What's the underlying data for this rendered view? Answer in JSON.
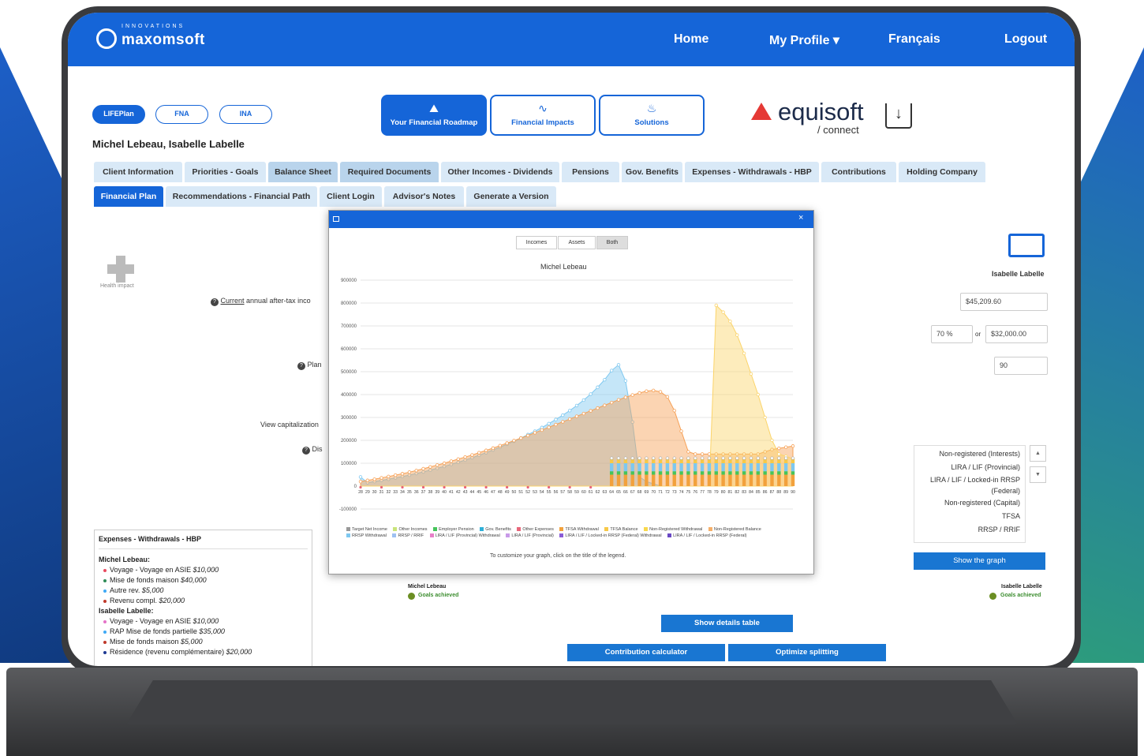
{
  "header": {
    "logo_top": "INNOVATIONS",
    "logo_name": "maxomsoft",
    "nav_home": "Home",
    "nav_profile": "My Profile ▾",
    "nav_lang": "Français",
    "nav_logout": "Logout"
  },
  "plan_pills": [
    "LIFEPlan",
    "FNA",
    "INA"
  ],
  "top_buttons": [
    {
      "label": "Your Financial Roadmap",
      "icon": "map-icon"
    },
    {
      "label": "Financial Impacts",
      "icon": "line-graph-icon"
    },
    {
      "label": "Solutions",
      "icon": "lightbulb-icon"
    }
  ],
  "partner": {
    "name": "equisoft",
    "sub": "/ connect"
  },
  "clients": "Michel Lebeau, Isabelle Labelle",
  "tabs_row1": [
    "Client Information",
    "Priorities - Goals",
    "Balance Sheet",
    "Required Documents",
    "Other Incomes - Dividends",
    "Pensions",
    "Gov. Benefits",
    "Expenses - Withdrawals - HBP",
    "Contributions",
    "Holding Company"
  ],
  "tabs_row2": [
    "Financial Plan",
    "Recommendations - Financial Path",
    "Client Login",
    "Advisor's Notes",
    "Generate a Version"
  ],
  "left": {
    "health_impact": "Health impact",
    "current_label": "Current",
    "current_rest": " annual after-tax inco",
    "plan_label": "Plan",
    "view_cap": "View capitalization",
    "dist_label": "Dis"
  },
  "modal": {
    "segments": [
      "Incomes",
      "Assets",
      "Both"
    ],
    "hint": "To customize your graph, click on the title of the legend."
  },
  "chart_data": {
    "type": "area",
    "title": "Michel Lebeau",
    "x": [
      28,
      29,
      30,
      31,
      32,
      33,
      34,
      35,
      36,
      37,
      38,
      39,
      40,
      41,
      42,
      43,
      44,
      45,
      46,
      47,
      48,
      49,
      50,
      51,
      52,
      53,
      54,
      55,
      56,
      57,
      58,
      59,
      60,
      61,
      62,
      63,
      64,
      65,
      66,
      67,
      68,
      69,
      70,
      71,
      72,
      73,
      74,
      75,
      76,
      77,
      78,
      79,
      80,
      81,
      82,
      83,
      84,
      85,
      86,
      87,
      88,
      89,
      90
    ],
    "ylim": [
      -100000,
      900000
    ],
    "yticks": [
      "900000",
      "800000",
      "700000",
      "600000",
      "500000",
      "400000",
      "300000",
      "200000",
      "100000",
      "0",
      "-100000"
    ],
    "series": [
      {
        "name": "Non-Registered Balance",
        "color": "#7ec8f0",
        "values": [
          40000,
          15000,
          20000,
          25000,
          30000,
          36000,
          42000,
          48000,
          55000,
          62000,
          70000,
          78000,
          86000,
          95000,
          104000,
          114000,
          124000,
          135000,
          146000,
          158000,
          170000,
          183000,
          196000,
          210000,
          225000,
          240000,
          256000,
          273000,
          291000,
          310000,
          330000,
          352000,
          376000,
          402000,
          432000,
          465000,
          505000,
          530000,
          460000,
          280000,
          40000,
          20000,
          10000,
          0,
          0,
          0,
          0,
          0,
          0,
          0,
          0,
          0,
          0,
          0,
          0,
          0,
          0,
          0,
          0,
          0,
          0,
          0,
          0
        ]
      },
      {
        "name": "RRSP / RRIF",
        "color": "#f6a055",
        "values": [
          20000,
          25000,
          30000,
          36000,
          42000,
          48000,
          54000,
          61000,
          68000,
          76000,
          84000,
          92000,
          100000,
          109000,
          118000,
          127000,
          136000,
          146000,
          156000,
          166000,
          177000,
          188000,
          199000,
          210000,
          221000,
          233000,
          245000,
          257000,
          269000,
          281000,
          293000,
          305000,
          317000,
          329000,
          341000,
          353000,
          365000,
          377000,
          388000,
          398000,
          407000,
          415000,
          418000,
          412000,
          390000,
          330000,
          240000,
          150000,
          140000,
          140000,
          140000,
          140000,
          140000,
          140000,
          140000,
          140000,
          140000,
          140000,
          150000,
          160000,
          165000,
          170000,
          175000
        ]
      },
      {
        "name": "TFSA Balance",
        "color": "#fbd46a",
        "values": [
          0,
          0,
          0,
          0,
          0,
          0,
          0,
          0,
          0,
          0,
          0,
          0,
          0,
          0,
          0,
          0,
          0,
          0,
          0,
          0,
          0,
          0,
          0,
          0,
          0,
          0,
          0,
          0,
          0,
          0,
          0,
          0,
          0,
          0,
          0,
          0,
          0,
          0,
          0,
          0,
          0,
          0,
          0,
          0,
          0,
          0,
          0,
          0,
          0,
          0,
          0,
          790000,
          760000,
          720000,
          660000,
          580000,
          490000,
          400000,
          300000,
          200000,
          140000,
          130000,
          120000
        ]
      }
    ],
    "bars_start": 64,
    "legend": [
      "Target Net Income",
      "Other Incomes",
      "Employer Pension",
      "Gov. Benefits",
      "Other Expenses",
      "TFSA Withdrawal",
      "TFSA Balance",
      "Non-Registered Withdrawal",
      "Non-Registered Balance",
      "RRSP Withdrawal",
      "RRSP / RRIF",
      "LIRA / LIF (Provincial) Withdrawal",
      "LIRA / LIF (Provincial)",
      "LIRA / LIF / Locked-in RRSP (Federal) Withdrawal",
      "LIRA / LIF / Locked-in RRSP (Federal)"
    ],
    "legend_colors": [
      "#999999",
      "#c9e47a",
      "#45c45a",
      "#2fb0d8",
      "#e8667a",
      "#f2a13c",
      "#f7c948",
      "#f8d84c",
      "#f6b06a",
      "#7ec8f0",
      "#9ec1f2",
      "#e680c8",
      "#c89ae8",
      "#8a5bd6",
      "#6a49c4"
    ]
  },
  "right": {
    "person": "Isabelle Labelle",
    "val1": "$45,209.60",
    "pct": "70 %",
    "or": "or",
    "val2": "$32,000.00",
    "age": "90",
    "list": [
      "Non-registered (Interests)",
      "LIRA / LIF (Provincial)",
      "LIRA / LIF / Locked-in RRSP (Federal)",
      "Non-registered (Capital)",
      "TFSA",
      "RRSP / RRIF"
    ],
    "up": "▲",
    "down": "▼",
    "show_graph": "Show the graph"
  },
  "goals": {
    "michel": "Michel Lebeau",
    "isabelle": "Isabelle Labelle",
    "achieved": "Goals achieved"
  },
  "expenses": {
    "title": "Expenses - Withdrawals - HBP",
    "p1": "Michel Lebeau:",
    "p1_items": [
      {
        "text": "Voyage - Voyage en ASIE ",
        "amount": "$10,000",
        "color": "#e84a5f"
      },
      {
        "text": "Mise de fonds maison ",
        "amount": "$40,000",
        "color": "#2e8b57"
      },
      {
        "text": "Autre rev. ",
        "amount": "$5,000",
        "color": "#3fa9f5"
      },
      {
        "text": "Revenu compl. ",
        "amount": "$20,000",
        "color": "#c0392b"
      }
    ],
    "p2": "Isabelle Labelle:",
    "p2_items": [
      {
        "text": "Voyage - Voyage en ASIE ",
        "amount": "$10,000",
        "color": "#e573c8"
      },
      {
        "text": "RAP Mise de fonds partielle ",
        "amount": "$35,000",
        "color": "#3fa9f5"
      },
      {
        "text": "Mise de fonds maison ",
        "amount": "$5,000",
        "color": "#c0392b"
      },
      {
        "text": "Résidence (revenu complémentaire) ",
        "amount": "$20,000",
        "color": "#1f3a93"
      }
    ]
  },
  "buttons": {
    "details": "Show details table",
    "contrib": "Contribution calculator",
    "optimize": "Optimize splitting"
  }
}
